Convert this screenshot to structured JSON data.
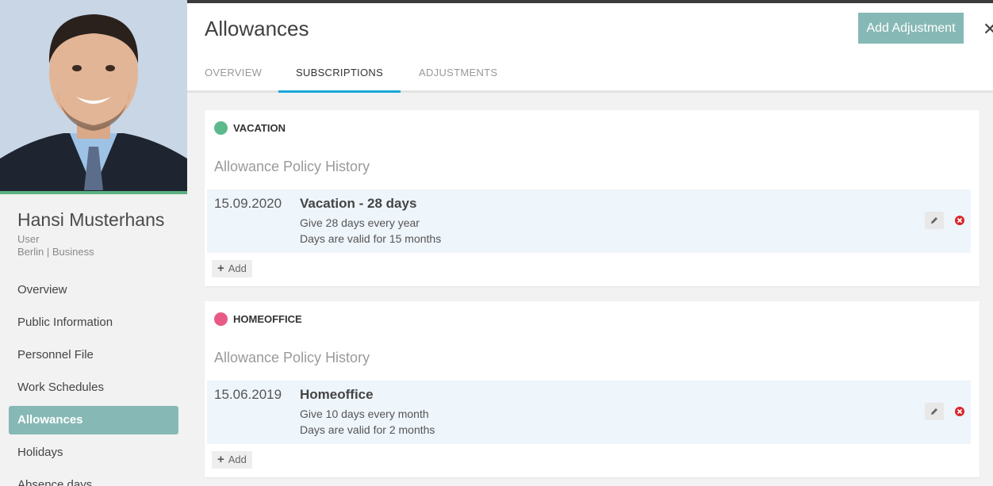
{
  "profile": {
    "name": "Hansi Musterhans",
    "role": "User",
    "location": "Berlin | Business"
  },
  "sidebar": {
    "items": [
      {
        "label": "Overview"
      },
      {
        "label": "Public Information"
      },
      {
        "label": "Personnel File"
      },
      {
        "label": "Work Schedules"
      },
      {
        "label": "Allowances",
        "active": true
      },
      {
        "label": "Holidays"
      },
      {
        "label": "Absence days"
      }
    ]
  },
  "header": {
    "title": "Allowances",
    "add_adjustment_label": "Add Adjustment",
    "close_symbol": "✕"
  },
  "tabs": [
    {
      "label": "OVERVIEW"
    },
    {
      "label": "SUBSCRIPTIONS",
      "active": true
    },
    {
      "label": "ADJUSTMENTS"
    }
  ],
  "cards": [
    {
      "label": "VACATION",
      "color": "#5cb98b",
      "history_title": "Allowance Policy History",
      "entry": {
        "date": "15.09.2020",
        "title": "Vacation - 28 days",
        "line1": "Give 28 days every year",
        "line2": "Days are valid for 15 months"
      },
      "add_label": "Add"
    },
    {
      "label": "HOMEOFFICE",
      "color": "#e85a85",
      "history_title": "Allowance Policy History",
      "entry": {
        "date": "15.06.2019",
        "title": "Homeoffice",
        "line1": "Give 10 days every month",
        "line2": "Days are valid for 2 months"
      },
      "add_label": "Add"
    }
  ],
  "colors": {
    "accent": "#86b9b5",
    "tab_active": "#1aa7d8",
    "delete": "#d9262b"
  }
}
